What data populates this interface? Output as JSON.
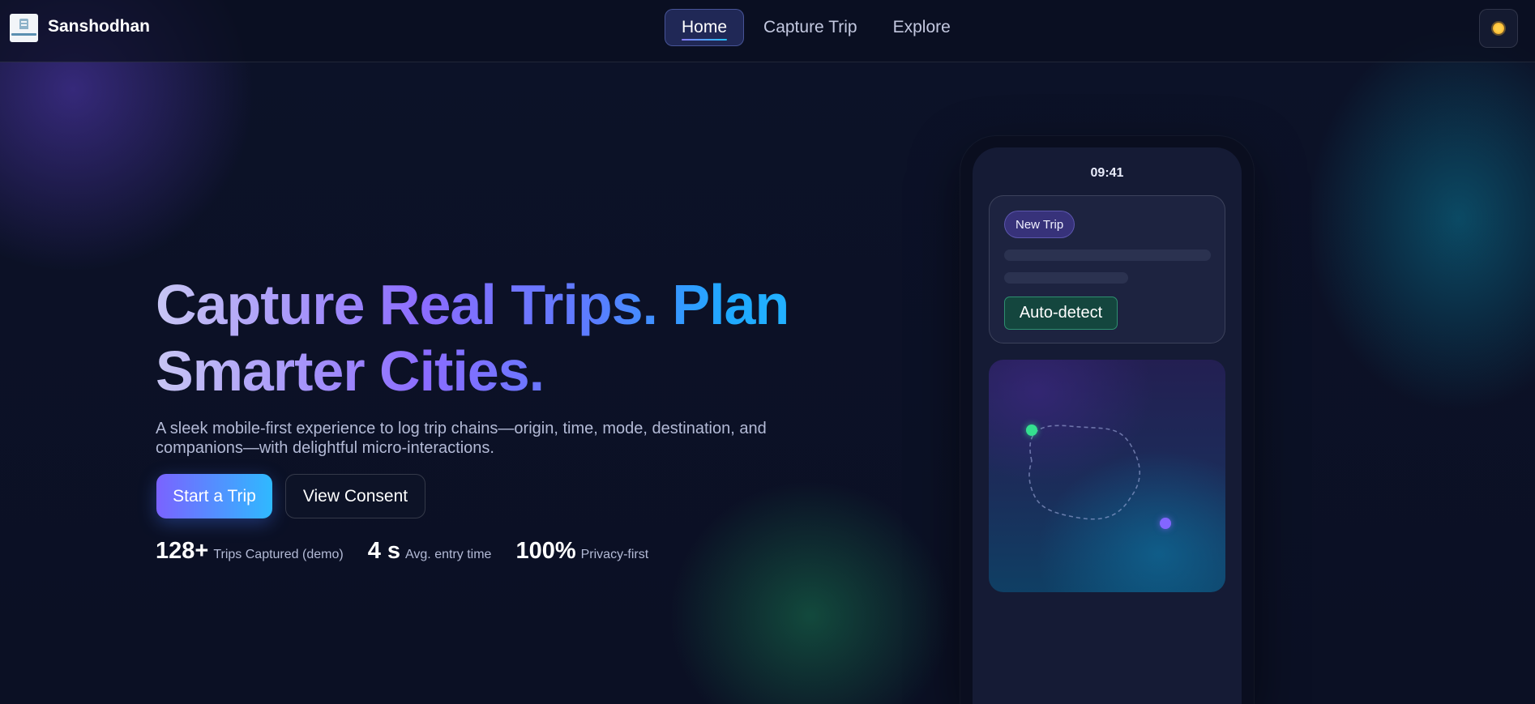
{
  "header": {
    "brand": "Sanshodhan",
    "nav": [
      {
        "label": "Home",
        "active": true
      },
      {
        "label": "Capture Trip",
        "active": false
      },
      {
        "label": "Explore",
        "active": false
      }
    ],
    "theme_toggle_icon": "sun-icon"
  },
  "hero": {
    "headline": "Capture Real Trips. Plan Smarter Cities.",
    "subtitle": "A sleek mobile-first experience to log trip chains—origin, time, mode, destination, and companions—with delightful micro-interactions.",
    "primary_button": "Start a Trip",
    "secondary_button": "View Consent",
    "stats": [
      {
        "value": "128+",
        "label": "Trips Captured (demo)"
      },
      {
        "value": "4 s",
        "label": "Avg. entry time"
      },
      {
        "value": "100%",
        "label": "Privacy-first"
      }
    ]
  },
  "phone": {
    "time": "09:41",
    "card": {
      "pill": "New Trip",
      "tag": "Auto-detect"
    }
  },
  "colors": {
    "background": "#0b1024",
    "accent_purple": "#7a63ff",
    "accent_cyan": "#2fb9ff",
    "start_dot": "#34e08f",
    "end_dot": "#8366ff"
  }
}
